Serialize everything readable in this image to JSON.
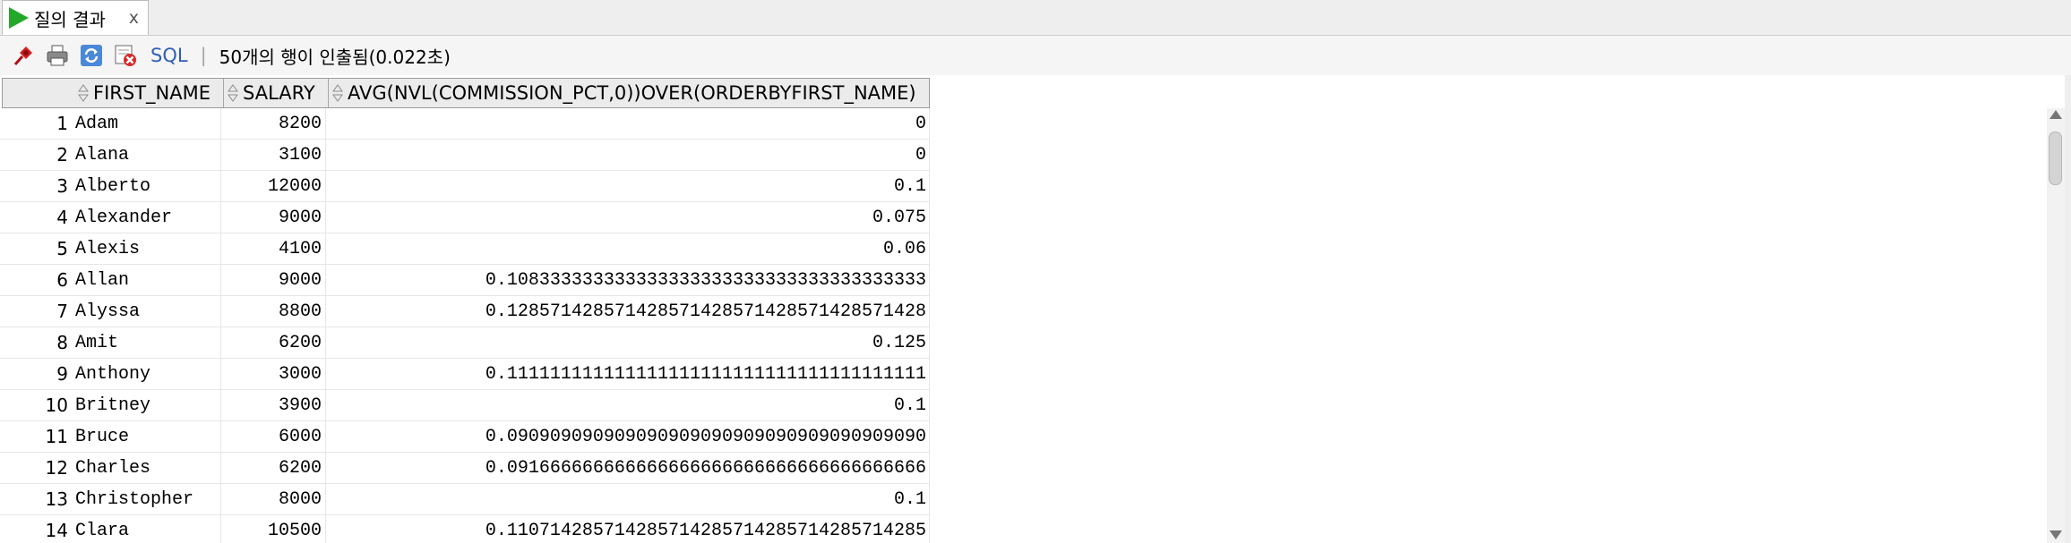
{
  "tab": {
    "label": "질의 결과",
    "close": "x",
    "icon": "run-icon"
  },
  "toolbar": {
    "icons": [
      "pin-icon",
      "print-icon",
      "refresh-icon",
      "delete-icon"
    ],
    "sql_label": "SQL",
    "separator": "|",
    "status": "50개의 행이 인출됨(0.022초)"
  },
  "grid": {
    "columns": [
      {
        "label": "FIRST_NAME"
      },
      {
        "label": "SALARY"
      },
      {
        "label": "AVG(NVL(COMMISSION_PCT,0))OVER(ORDERBYFIRST_NAME)"
      }
    ],
    "rows": [
      {
        "num": "1",
        "first_name": "Adam",
        "salary": "8200",
        "avg": "0"
      },
      {
        "num": "2",
        "first_name": "Alana",
        "salary": "3100",
        "avg": "0"
      },
      {
        "num": "3",
        "first_name": "Alberto",
        "salary": "12000",
        "avg": "0.1"
      },
      {
        "num": "4",
        "first_name": "Alexander",
        "salary": "9000",
        "avg": "0.075"
      },
      {
        "num": "5",
        "first_name": "Alexis",
        "salary": "4100",
        "avg": "0.06"
      },
      {
        "num": "6",
        "first_name": "Allan",
        "salary": "9000",
        "avg": "0.108333333333333333333333333333333333333"
      },
      {
        "num": "7",
        "first_name": "Alyssa",
        "salary": "8800",
        "avg": "0.128571428571428571428571428571428571428"
      },
      {
        "num": "8",
        "first_name": "Amit",
        "salary": "6200",
        "avg": "0.125"
      },
      {
        "num": "9",
        "first_name": "Anthony",
        "salary": "3000",
        "avg": "0.111111111111111111111111111111111111111"
      },
      {
        "num": "10",
        "first_name": "Britney",
        "salary": "3900",
        "avg": "0.1"
      },
      {
        "num": "11",
        "first_name": "Bruce",
        "salary": "6000",
        "avg": "0.090909090909090909090909090909090909090"
      },
      {
        "num": "12",
        "first_name": "Charles",
        "salary": "6200",
        "avg": "0.091666666666666666666666666666666666666"
      },
      {
        "num": "13",
        "first_name": "Christopher",
        "salary": "8000",
        "avg": "0.1"
      },
      {
        "num": "14",
        "first_name": "Clara",
        "salary": "10500",
        "avg": "0.110714285714285714285714285714285714285"
      }
    ]
  },
  "colors": {
    "accent_sql": "#2f5db6",
    "run_green": "#24a82a"
  }
}
